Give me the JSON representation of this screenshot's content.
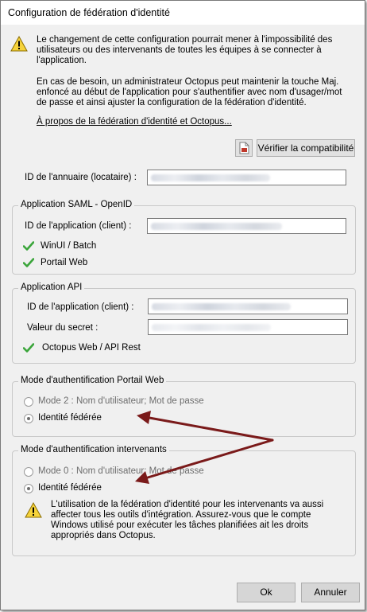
{
  "window": {
    "title": "Configuration de fédération d'identité"
  },
  "top_warning": {
    "icon": "warning-icon",
    "paragraph1": "Le changement de cette configuration pourrait mener à l'impossibilité des utilisateurs ou des intervenants de toutes les équipes à se connecter à l'application.",
    "paragraph2": "En cas de besoin, un administrateur Octopus peut maintenir la touche Maj. enfoncé au début de l'application pour s'authentifier avec nom d'usager/mot de passe et ainsi ajuster la configuration de la fédération d'identité.",
    "link": "À propos de la fédération d'identité et Octopus..."
  },
  "toolbar": {
    "pdf_icon": "pdf-icon",
    "verify_label": "Vérifier la compatibilité"
  },
  "directory": {
    "label": "ID de l'annuaire (locataire) :"
  },
  "saml": {
    "title": "Application SAML - OpenID",
    "app_id_label": "ID de l'application (client) :",
    "checks": [
      "WinUI / Batch",
      "Portail Web"
    ]
  },
  "api": {
    "title": "Application API",
    "app_id_label": "ID de l'application (client) :",
    "secret_label": "Valeur du secret :",
    "checks": [
      "Octopus Web / API Rest"
    ]
  },
  "portal_auth": {
    "title": "Mode d'authentification Portail Web",
    "options": [
      {
        "label": "Mode 2 : Nom d'utilisateur; Mot de passe",
        "selected": false
      },
      {
        "label": "Identité fédérée",
        "selected": true
      }
    ]
  },
  "intervenant_auth": {
    "title": "Mode d'authentification intervenants",
    "options": [
      {
        "label": "Mode 0 : Nom d'utilisateur; Mot de passe",
        "selected": false
      },
      {
        "label": "Identité fédérée",
        "selected": true
      }
    ],
    "warning": "L'utilisation de la fédération d'identité pour les intervenants va aussi affecter tous les outils d'intégration. Assurez-vous que le compte Windows utilisé pour exécuter les tâches planifiées ait les droits appropriés dans Octopus."
  },
  "footer": {
    "ok_label": "Ok",
    "cancel_label": "Annuler"
  },
  "colors": {
    "check_green": "#3aa53a",
    "arrow_red": "#7a1a1a",
    "warning_yellow": "#f6d33b"
  }
}
